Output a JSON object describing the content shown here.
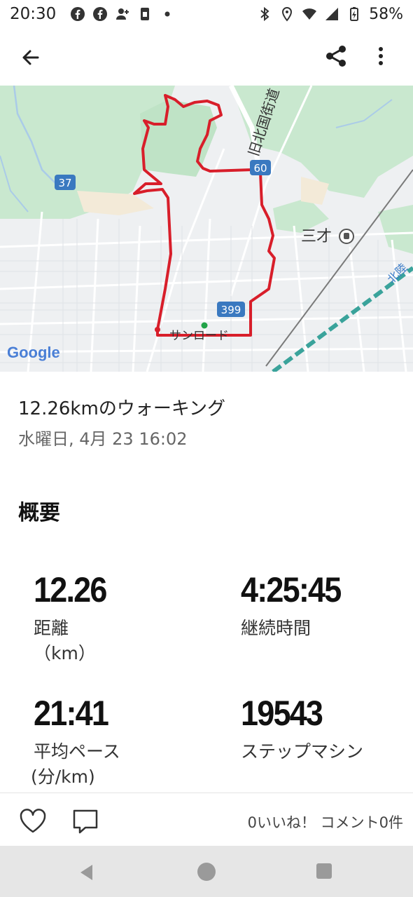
{
  "status_bar": {
    "time": "20:30",
    "battery": "58%",
    "icons": [
      "facebook-icon",
      "facebook-icon",
      "person-add-icon",
      "sim-icon",
      "dot-icon",
      "bluetooth-icon",
      "location-icon",
      "wifi-icon",
      "signal-icon",
      "battery-icon"
    ]
  },
  "app_bar": {
    "icons": [
      "back-arrow-icon",
      "share-icon",
      "more-vert-icon"
    ]
  },
  "map": {
    "route_color": "#d81e2a",
    "labels": {
      "road_37": "37",
      "road_60": "60",
      "road_399": "399",
      "old_road": "旧北国街道",
      "station": "三才",
      "place": "サンロード",
      "line": "北陸",
      "google": "Google"
    }
  },
  "activity": {
    "title": "12.26kmのウォーキング",
    "date": "水曜日, 4月 23 16:02"
  },
  "summary": {
    "heading": "概要",
    "stats": [
      {
        "value": "12.26",
        "label": "距離",
        "unit": "（km）"
      },
      {
        "value": "4:25:45",
        "label": "継続時間",
        "unit": ""
      },
      {
        "value": "21:41",
        "label": "平均ペース",
        "unit": "(分/km)"
      },
      {
        "value": "19543",
        "label": "ステップマシン",
        "unit": ""
      }
    ]
  },
  "actions": {
    "counts": "0いいね！ コメント0件"
  },
  "nav": {
    "icons": [
      "nav-back-icon",
      "nav-home-icon",
      "nav-recent-icon"
    ]
  }
}
